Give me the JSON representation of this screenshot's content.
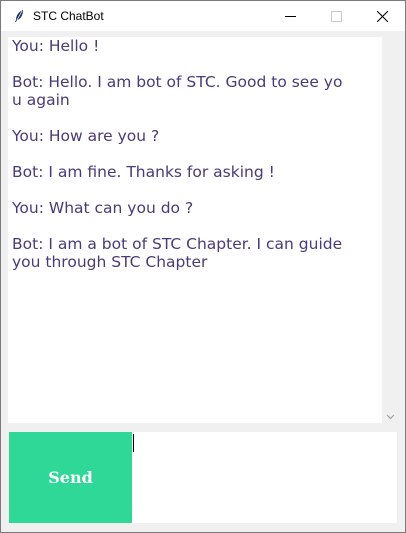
{
  "window": {
    "title": "STC ChatBot",
    "icons": {
      "app": "feather-icon",
      "minimize": "minimize-icon",
      "maximize": "maximize-icon",
      "close": "close-icon"
    }
  },
  "chat": {
    "messages": [
      {
        "text": "You: Hello !"
      },
      {
        "text": "Bot: Hello. I am bot of STC. Good to see yo\nu again"
      },
      {
        "text": "You: How are you ?"
      },
      {
        "text": "Bot: I am fine. Thanks for asking !"
      },
      {
        "text": "You: What can you do ?"
      },
      {
        "text": "Bot: I am a bot of STC Chapter. I can guide\nyou through STC Chapter"
      }
    ],
    "text_color": "#4b3a78"
  },
  "composer": {
    "send_label": "Send",
    "input_value": "",
    "send_color": "#2fd896"
  }
}
